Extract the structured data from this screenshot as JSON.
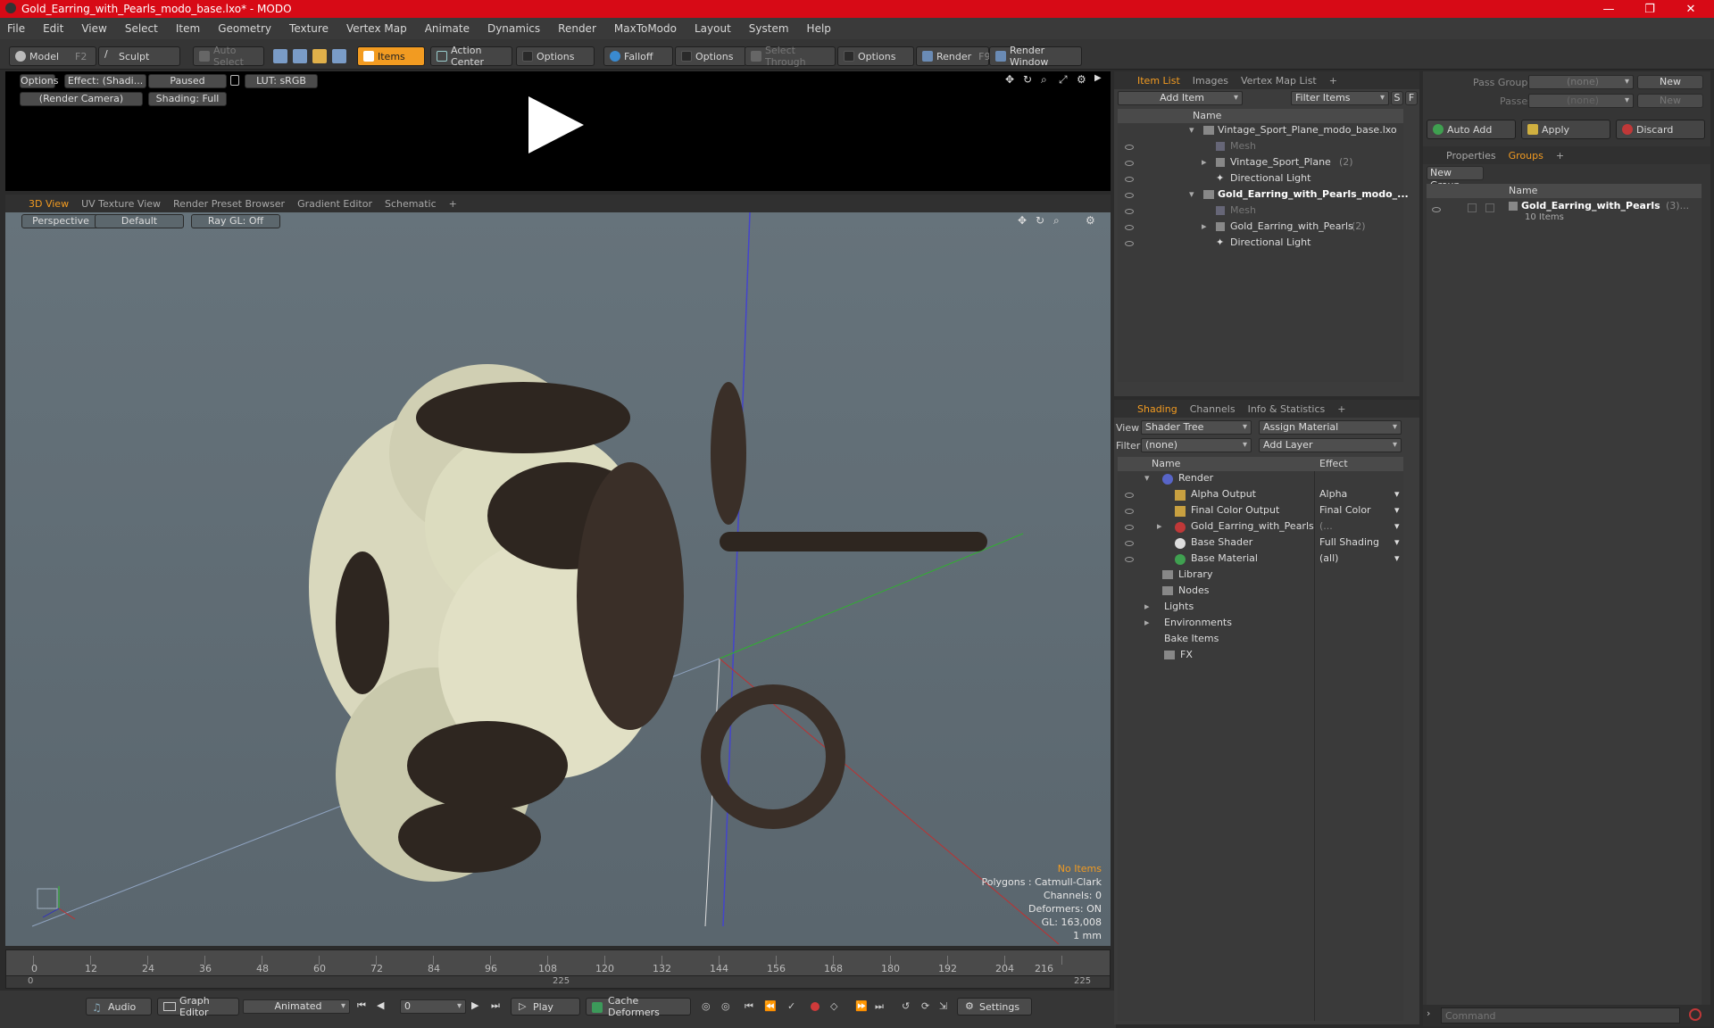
{
  "window": {
    "title": "Gold_Earring_with_Pearls_modo_base.lxo* - MODO"
  },
  "menu": [
    "File",
    "Edit",
    "View",
    "Select",
    "Item",
    "Geometry",
    "Texture",
    "Vertex Map",
    "Animate",
    "Dynamics",
    "Render",
    "MaxToModo",
    "Layout",
    "System",
    "Help"
  ],
  "toolbar": {
    "model": "Model",
    "model_key": "F2",
    "sculpt": "Sculpt",
    "auto_select": "Auto Select",
    "items": "Items",
    "action_center": "Action Center",
    "options1": "Options",
    "falloff": "Falloff",
    "options2": "Options",
    "select_through": "Select Through",
    "options3": "Options",
    "render": "Render",
    "render_key": "F9",
    "render_window": "Render Window"
  },
  "preview": {
    "options": "Options",
    "effect": "Effect: (Shadi...",
    "paused": "Paused",
    "lut": "LUT: sRGB",
    "camera": "(Render Camera)",
    "shading": "Shading: Full"
  },
  "viewport": {
    "tabs": [
      "3D View",
      "UV Texture View",
      "Render Preset Browser",
      "Gradient Editor",
      "Schematic",
      "+"
    ],
    "perspective": "Perspective",
    "default": "Default",
    "raygl": "Ray GL: Off",
    "info": {
      "no_items": "No Items",
      "polygons": "Polygons : Catmull-Clark",
      "channels": "Channels: 0",
      "deformers": "Deformers: ON",
      "gl": "GL: 163,008",
      "scale": "1 mm"
    }
  },
  "timeline": {
    "ticks": [
      "0",
      "12",
      "24",
      "36",
      "48",
      "60",
      "72",
      "84",
      "96",
      "108",
      "120",
      "132",
      "144",
      "156",
      "168",
      "180",
      "192",
      "204",
      "216"
    ],
    "start": "0",
    "mid": "225",
    "end": "225"
  },
  "bottombar": {
    "audio": "Audio",
    "graph_editor": "Graph Editor",
    "animated": "Animated",
    "frame": "0",
    "play": "Play",
    "cache": "Cache Deformers",
    "settings": "Settings"
  },
  "itemlist": {
    "tabs": [
      "Item List",
      "Images",
      "Vertex Map List",
      "+"
    ],
    "add_item": "Add Item",
    "filter": "Filter Items",
    "s": "S",
    "f": "F",
    "col_name": "Name",
    "rows": [
      {
        "label": "Vintage_Sport_Plane_modo_base.lxo",
        "dim": false
      },
      {
        "label": "Mesh",
        "dim": true
      },
      {
        "label": "Vintage_Sport_Plane",
        "count": "(2)",
        "dim": false
      },
      {
        "label": "Directional Light",
        "dim": false
      },
      {
        "label": "Gold_Earring_with_Pearls_modo_...",
        "dim": false
      },
      {
        "label": "Mesh",
        "dim": true
      },
      {
        "label": "Gold_Earring_with_Pearls",
        "count": "(2)",
        "dim": false
      },
      {
        "label": "Directional Light",
        "dim": false
      }
    ]
  },
  "shading": {
    "tabs": [
      "Shading",
      "Channels",
      "Info & Statistics",
      "+"
    ],
    "view_label": "View",
    "view_value": "Shader Tree",
    "assign": "Assign Material",
    "filter_label": "Filter",
    "filter_value": "(none)",
    "add_layer": "Add Layer",
    "col_name": "Name",
    "col_effect": "Effect",
    "rows": [
      {
        "label": "Render",
        "effect": ""
      },
      {
        "label": "Alpha Output",
        "effect": "Alpha"
      },
      {
        "label": "Final Color Output",
        "effect": "Final Color"
      },
      {
        "label": "Gold_Earring_with_Pearls",
        "effect": "(..."
      },
      {
        "label": "Base Shader",
        "effect": "Full Shading"
      },
      {
        "label": "Base Material",
        "effect": "(all)"
      },
      {
        "label": "Library",
        "effect": ""
      },
      {
        "label": "Nodes",
        "effect": ""
      },
      {
        "label": "Lights",
        "effect": ""
      },
      {
        "label": "Environments",
        "effect": ""
      },
      {
        "label": "Bake Items",
        "effect": ""
      },
      {
        "label": "FX",
        "effect": ""
      }
    ]
  },
  "groups": {
    "pass_groups": "Pass Groups",
    "passes": "Passes",
    "none": "(none)",
    "new": "New",
    "auto_add": "Auto Add",
    "apply": "Apply",
    "discard": "Discard",
    "tabs": [
      "Properties",
      "Groups",
      "+"
    ],
    "new_group": "New Group",
    "col_name": "Name",
    "group_name": "Gold_Earring_with_Pearls",
    "group_count": "(3)...",
    "group_items": "10 Items"
  },
  "command": {
    "placeholder": "Command"
  },
  "colors": {
    "accent": "#f29b21",
    "titlebar": "#d70a16"
  }
}
